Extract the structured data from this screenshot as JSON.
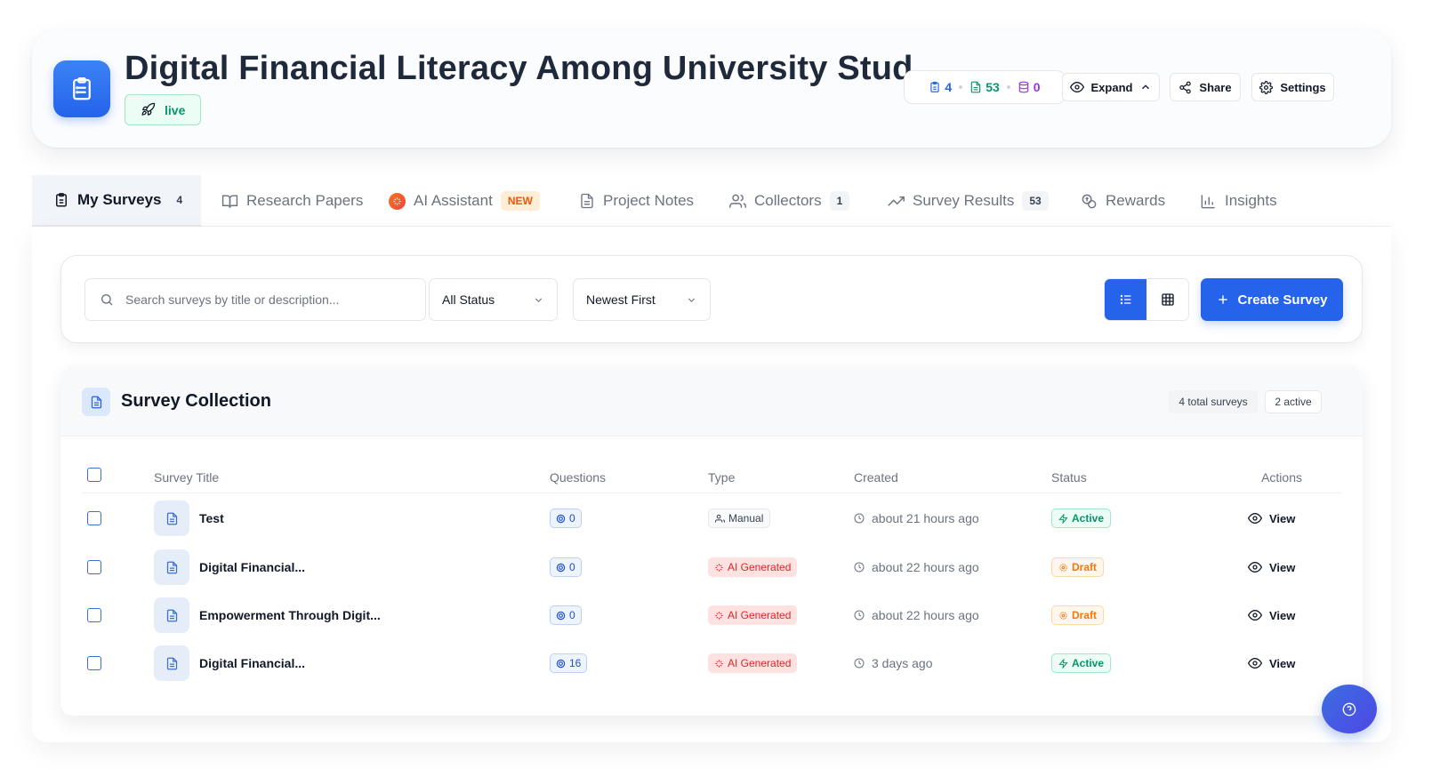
{
  "project": {
    "title": "Digital Financial Literacy Among University Stud...",
    "status": "live"
  },
  "stats": {
    "surveys": "4",
    "responses": "53",
    "data": "0",
    "colors": {
      "surveys": "#2563eb",
      "responses": "#059669",
      "data": "#9333ea"
    }
  },
  "header_buttons": {
    "expand": "Expand",
    "share": "Share",
    "settings": "Settings"
  },
  "tabs": [
    {
      "label": "My Surveys",
      "count": "4",
      "icon": "clipboard-icon",
      "active": true
    },
    {
      "label": "Research Papers",
      "icon": "book-icon"
    },
    {
      "label": "AI Assistant",
      "badge": "NEW",
      "icon": "sparkle-icon"
    },
    {
      "label": "Project Notes",
      "icon": "note-icon"
    },
    {
      "label": "Collectors",
      "count": "1",
      "icon": "users-icon"
    },
    {
      "label": "Survey Results",
      "count": "53",
      "icon": "trending-up-icon"
    },
    {
      "label": "Rewards",
      "icon": "reward-icon"
    },
    {
      "label": "Insights",
      "icon": "bar-chart-icon"
    }
  ],
  "toolbar": {
    "search_placeholder": "Search surveys by title or description...",
    "status_filter": "All Status",
    "sort": "Newest First",
    "create_label": "Create Survey"
  },
  "collection": {
    "title": "Survey Collection",
    "total_badge": "4 total surveys",
    "active_badge": "2 active"
  },
  "table": {
    "headers": {
      "title": "Survey Title",
      "questions": "Questions",
      "type": "Type",
      "created": "Created",
      "status": "Status",
      "actions": "Actions"
    },
    "rows": [
      {
        "title": "Test",
        "questions": "0",
        "type": "Manual",
        "created": "about 21 hours ago",
        "status": "Active",
        "action": "View"
      },
      {
        "title": "Digital Financial...",
        "questions": "0",
        "type": "AI Generated",
        "created": "about 22 hours ago",
        "status": "Draft",
        "action": "View"
      },
      {
        "title": "Empowerment Through Digit...",
        "questions": "0",
        "type": "AI Generated",
        "created": "about 22 hours ago",
        "status": "Draft",
        "action": "View"
      },
      {
        "title": "Digital Financial...",
        "questions": "16",
        "type": "AI Generated",
        "created": "3 days ago",
        "status": "Active",
        "action": "View"
      }
    ]
  },
  "colors": {
    "primary": "#2563eb",
    "active_green": "#059669",
    "draft_orange": "#ea7a12",
    "ai_red": "#dc2626"
  }
}
